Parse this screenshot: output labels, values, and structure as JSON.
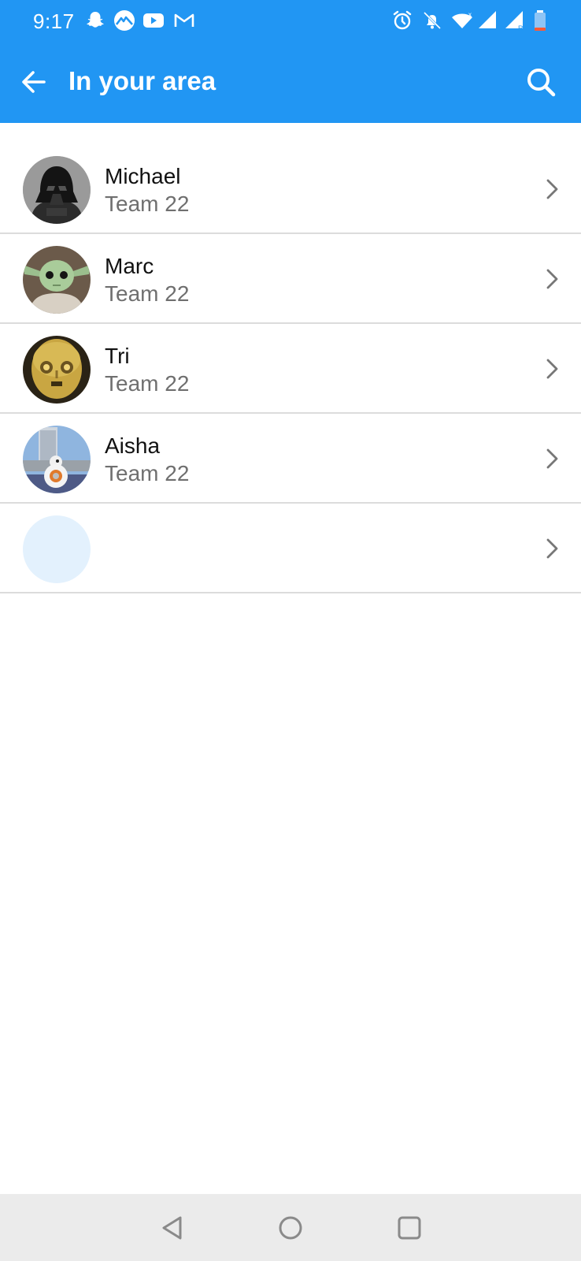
{
  "status_bar": {
    "time": "9:17",
    "icons_left": [
      "snapchat-icon",
      "mountain-app-icon",
      "youtube-icon",
      "gmail-icon"
    ],
    "icons_right": [
      "alarm-icon",
      "mute-icon",
      "wifi-icon",
      "signal-icon",
      "signal-roaming-icon",
      "battery-low-icon"
    ]
  },
  "app_bar": {
    "title": "In your area",
    "color": "#2196F3"
  },
  "list": [
    {
      "name": "Michael",
      "subtitle": "Team 22",
      "avatar": "darth-vader-avatar"
    },
    {
      "name": "Marc",
      "subtitle": "Team 22",
      "avatar": "baby-yoda-avatar"
    },
    {
      "name": "Tri",
      "subtitle": "Team 22",
      "avatar": "c3po-avatar"
    },
    {
      "name": "Aisha",
      "subtitle": "Team 22",
      "avatar": "bb8-avatar"
    },
    {
      "name": "",
      "subtitle": "",
      "avatar": "placeholder-avatar"
    }
  ]
}
